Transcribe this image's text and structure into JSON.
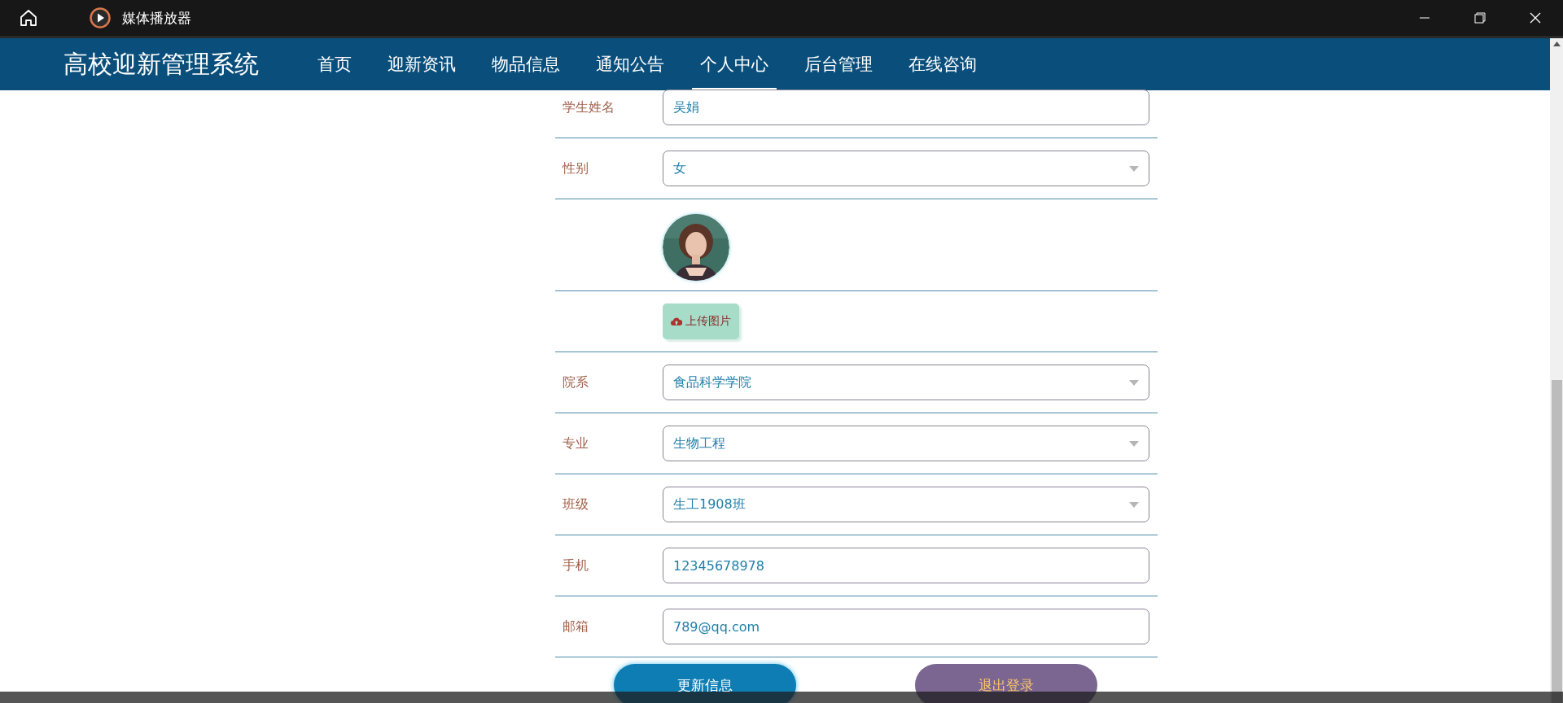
{
  "window": {
    "title": "媒体播放器"
  },
  "nav": {
    "brand": "高校迎新管理系统",
    "items": [
      {
        "label": "首页",
        "selected": false
      },
      {
        "label": "迎新资讯",
        "selected": false
      },
      {
        "label": "物品信息",
        "selected": false
      },
      {
        "label": "通知公告",
        "selected": false
      },
      {
        "label": "个人中心",
        "selected": true
      },
      {
        "label": "后台管理",
        "selected": false
      },
      {
        "label": "在线咨询",
        "selected": false
      }
    ]
  },
  "form": {
    "rows": [
      {
        "kind": "text",
        "label": "学生姓名",
        "value": "吴娟"
      },
      {
        "kind": "select",
        "label": "性别",
        "value": "女"
      },
      {
        "kind": "avatar"
      },
      {
        "kind": "upload",
        "button": "上传图片"
      },
      {
        "kind": "select",
        "label": "院系",
        "value": "食品科学学院"
      },
      {
        "kind": "select",
        "label": "专业",
        "value": "生物工程"
      },
      {
        "kind": "select",
        "label": "班级",
        "value": "生工1908班"
      },
      {
        "kind": "text",
        "label": "手机",
        "value": "12345678978"
      },
      {
        "kind": "text",
        "label": "邮箱",
        "value": "789@qq.com"
      }
    ]
  },
  "actions": [
    {
      "kind": "primary",
      "label": "更新信息"
    },
    {
      "kind": "secondary",
      "label": "退出登录"
    }
  ]
}
